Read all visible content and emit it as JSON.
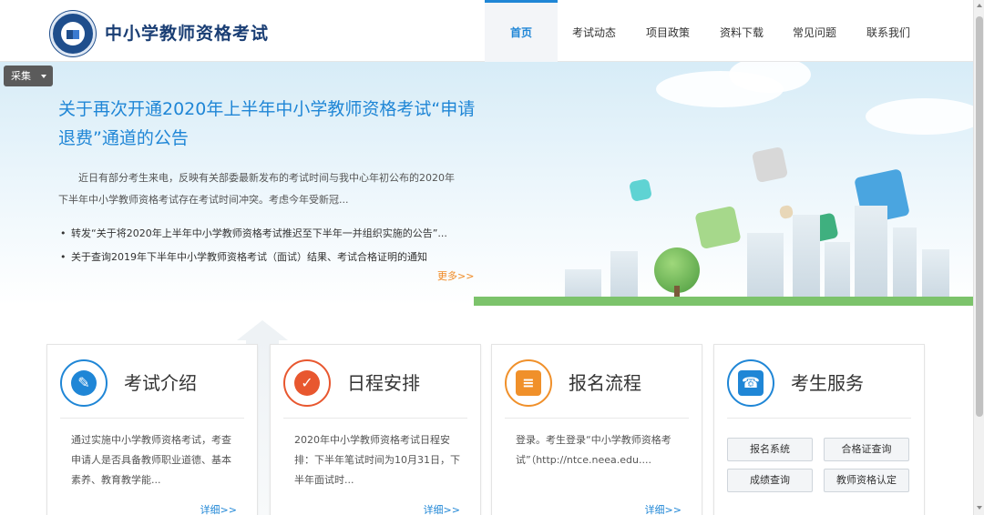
{
  "header": {
    "site_title": "中小学教师资格考试",
    "nav": [
      {
        "label": "首页",
        "active": true
      },
      {
        "label": "考试动态",
        "active": false
      },
      {
        "label": "项目政策",
        "active": false
      },
      {
        "label": "资料下载",
        "active": false
      },
      {
        "label": "常见问题",
        "active": false
      },
      {
        "label": "联系我们",
        "active": false
      }
    ]
  },
  "collect_button": {
    "label": "采集"
  },
  "banner": {
    "title": "关于再次开通2020年上半年中小学教师资格考试“申请退费”通道的公告",
    "summary": "近日有部分考生来电，反映有关部委最新发布的考试时间与我中心年初公布的2020年下半年中小学教师资格考试存在考试时间冲突。考虑今年受新冠...",
    "list": [
      "转发“关于将2020年上半年中小学教师资格考试推迟至下半年一并组织实施的公告”...",
      "关于查询2019年下半年中小学教师资格考试（面试）结果、考试合格证明的通知"
    ],
    "more": "更多>>"
  },
  "cards": [
    {
      "title": "考试介绍",
      "icon": "edit-document-icon",
      "color": "#1f86d6",
      "text": "通过实施中小学教师资格考试，考查申请人是否具备教师职业道德、基本素养、教育教学能...",
      "more": "详细>>"
    },
    {
      "title": "日程安排",
      "icon": "check-icon",
      "color": "#e8572f",
      "text": "2020年中小学教师资格考试日程安排：下半年笔试时间为10月31日，下半年面试时...",
      "more": "详细>>"
    },
    {
      "title": "报名流程",
      "icon": "form-icon",
      "color": "#f0902a",
      "text": "登录。考生登录“中小学教师资格考试”（http://ntce.neea.edu....",
      "more": "详细>>"
    },
    {
      "title": "考生服务",
      "icon": "contacts-icon",
      "color": "#1f86d6",
      "buttons": [
        "报名系统",
        "合格证查询",
        "成绩查询",
        "教师资格认定"
      ]
    }
  ]
}
